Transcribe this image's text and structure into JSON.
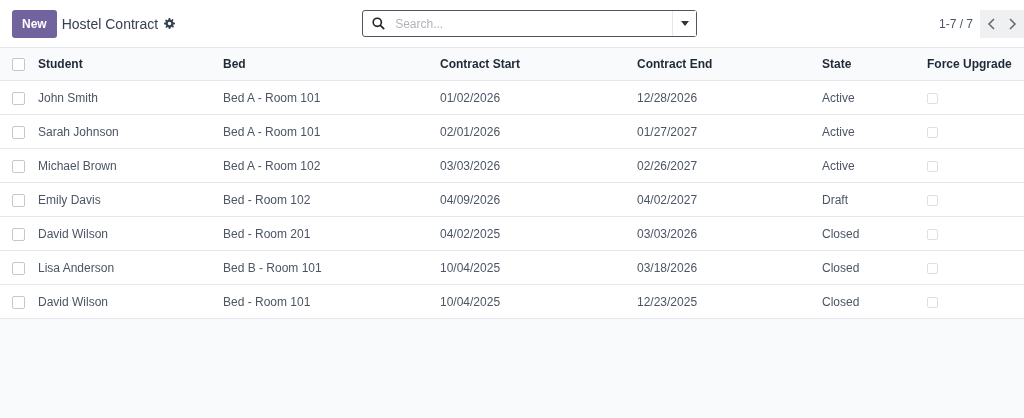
{
  "control_panel": {
    "new_button": "New",
    "title": "Hostel Contract",
    "search": {
      "placeholder": "Search..."
    },
    "pager": "1-7 / 7"
  },
  "table": {
    "select_all": {
      "checked": false
    },
    "columns": [
      "Student",
      "Bed",
      "Contract Start",
      "Contract End",
      "State",
      "Force Upgrade"
    ],
    "rows": [
      {
        "selected": false,
        "student": "John Smith",
        "bed": "Bed A - Room 101",
        "start": "01/02/2026",
        "end": "12/28/2026",
        "state": "Active",
        "force_upgrade": false
      },
      {
        "selected": false,
        "student": "Sarah Johnson",
        "bed": "Bed A - Room 101",
        "start": "02/01/2026",
        "end": "01/27/2027",
        "state": "Active",
        "force_upgrade": false
      },
      {
        "selected": false,
        "student": "Michael Brown",
        "bed": "Bed A - Room 102",
        "start": "03/03/2026",
        "end": "02/26/2027",
        "state": "Active",
        "force_upgrade": false
      },
      {
        "selected": false,
        "student": "Emily Davis",
        "bed": "Bed - Room 102",
        "start": "04/09/2026",
        "end": "04/02/2027",
        "state": "Draft",
        "force_upgrade": false
      },
      {
        "selected": false,
        "student": "David Wilson",
        "bed": "Bed - Room 201",
        "start": "04/02/2025",
        "end": "03/03/2026",
        "state": "Closed",
        "force_upgrade": false
      },
      {
        "selected": false,
        "student": "Lisa Anderson",
        "bed": "Bed B - Room 101",
        "start": "10/04/2025",
        "end": "03/18/2026",
        "state": "Closed",
        "force_upgrade": false
      },
      {
        "selected": false,
        "student": "David Wilson",
        "bed": "Bed - Room 101",
        "start": "10/04/2025",
        "end": "12/23/2025",
        "state": "Closed",
        "force_upgrade": false
      }
    ]
  }
}
